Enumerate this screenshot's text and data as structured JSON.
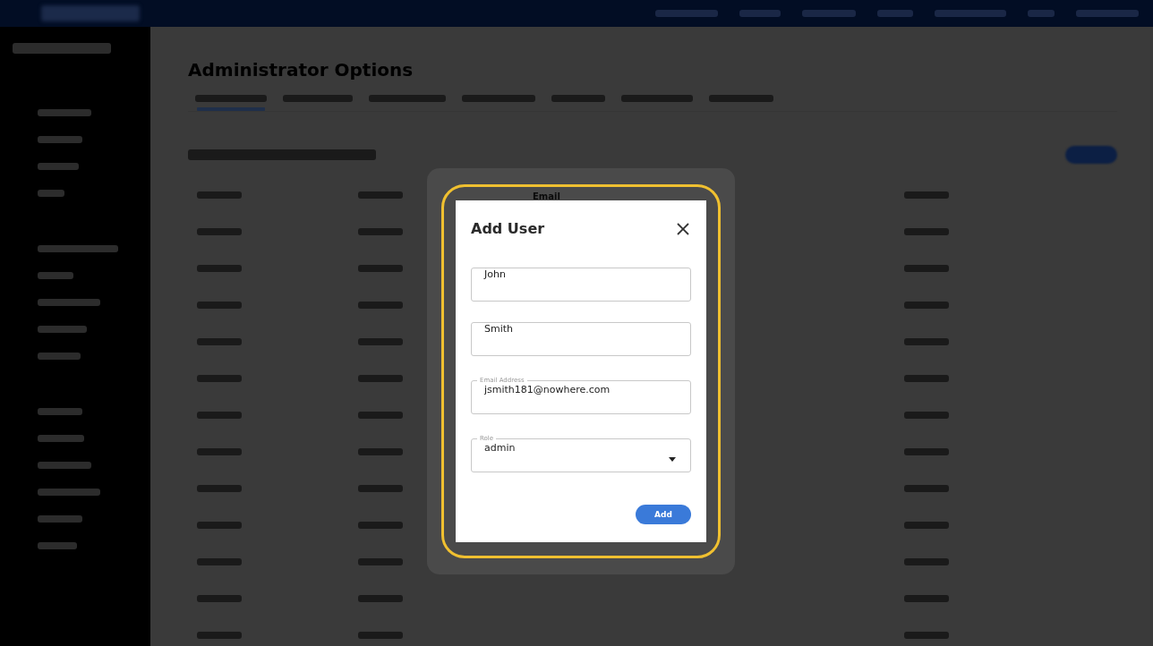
{
  "page": {
    "title": "Administrator Options"
  },
  "table": {
    "columns": [
      {
        "label": "Email"
      }
    ]
  },
  "dialog": {
    "title": "Add User",
    "fields": [
      {
        "kind": "text",
        "value": "John"
      },
      {
        "kind": "text",
        "value": "Smith"
      },
      {
        "kind": "text",
        "label": "Email Address",
        "value": "jsmith181@nowhere.com"
      },
      {
        "kind": "select",
        "label": "Role",
        "value": "admin"
      }
    ],
    "buttons": [
      {
        "label": "Add"
      }
    ]
  }
}
